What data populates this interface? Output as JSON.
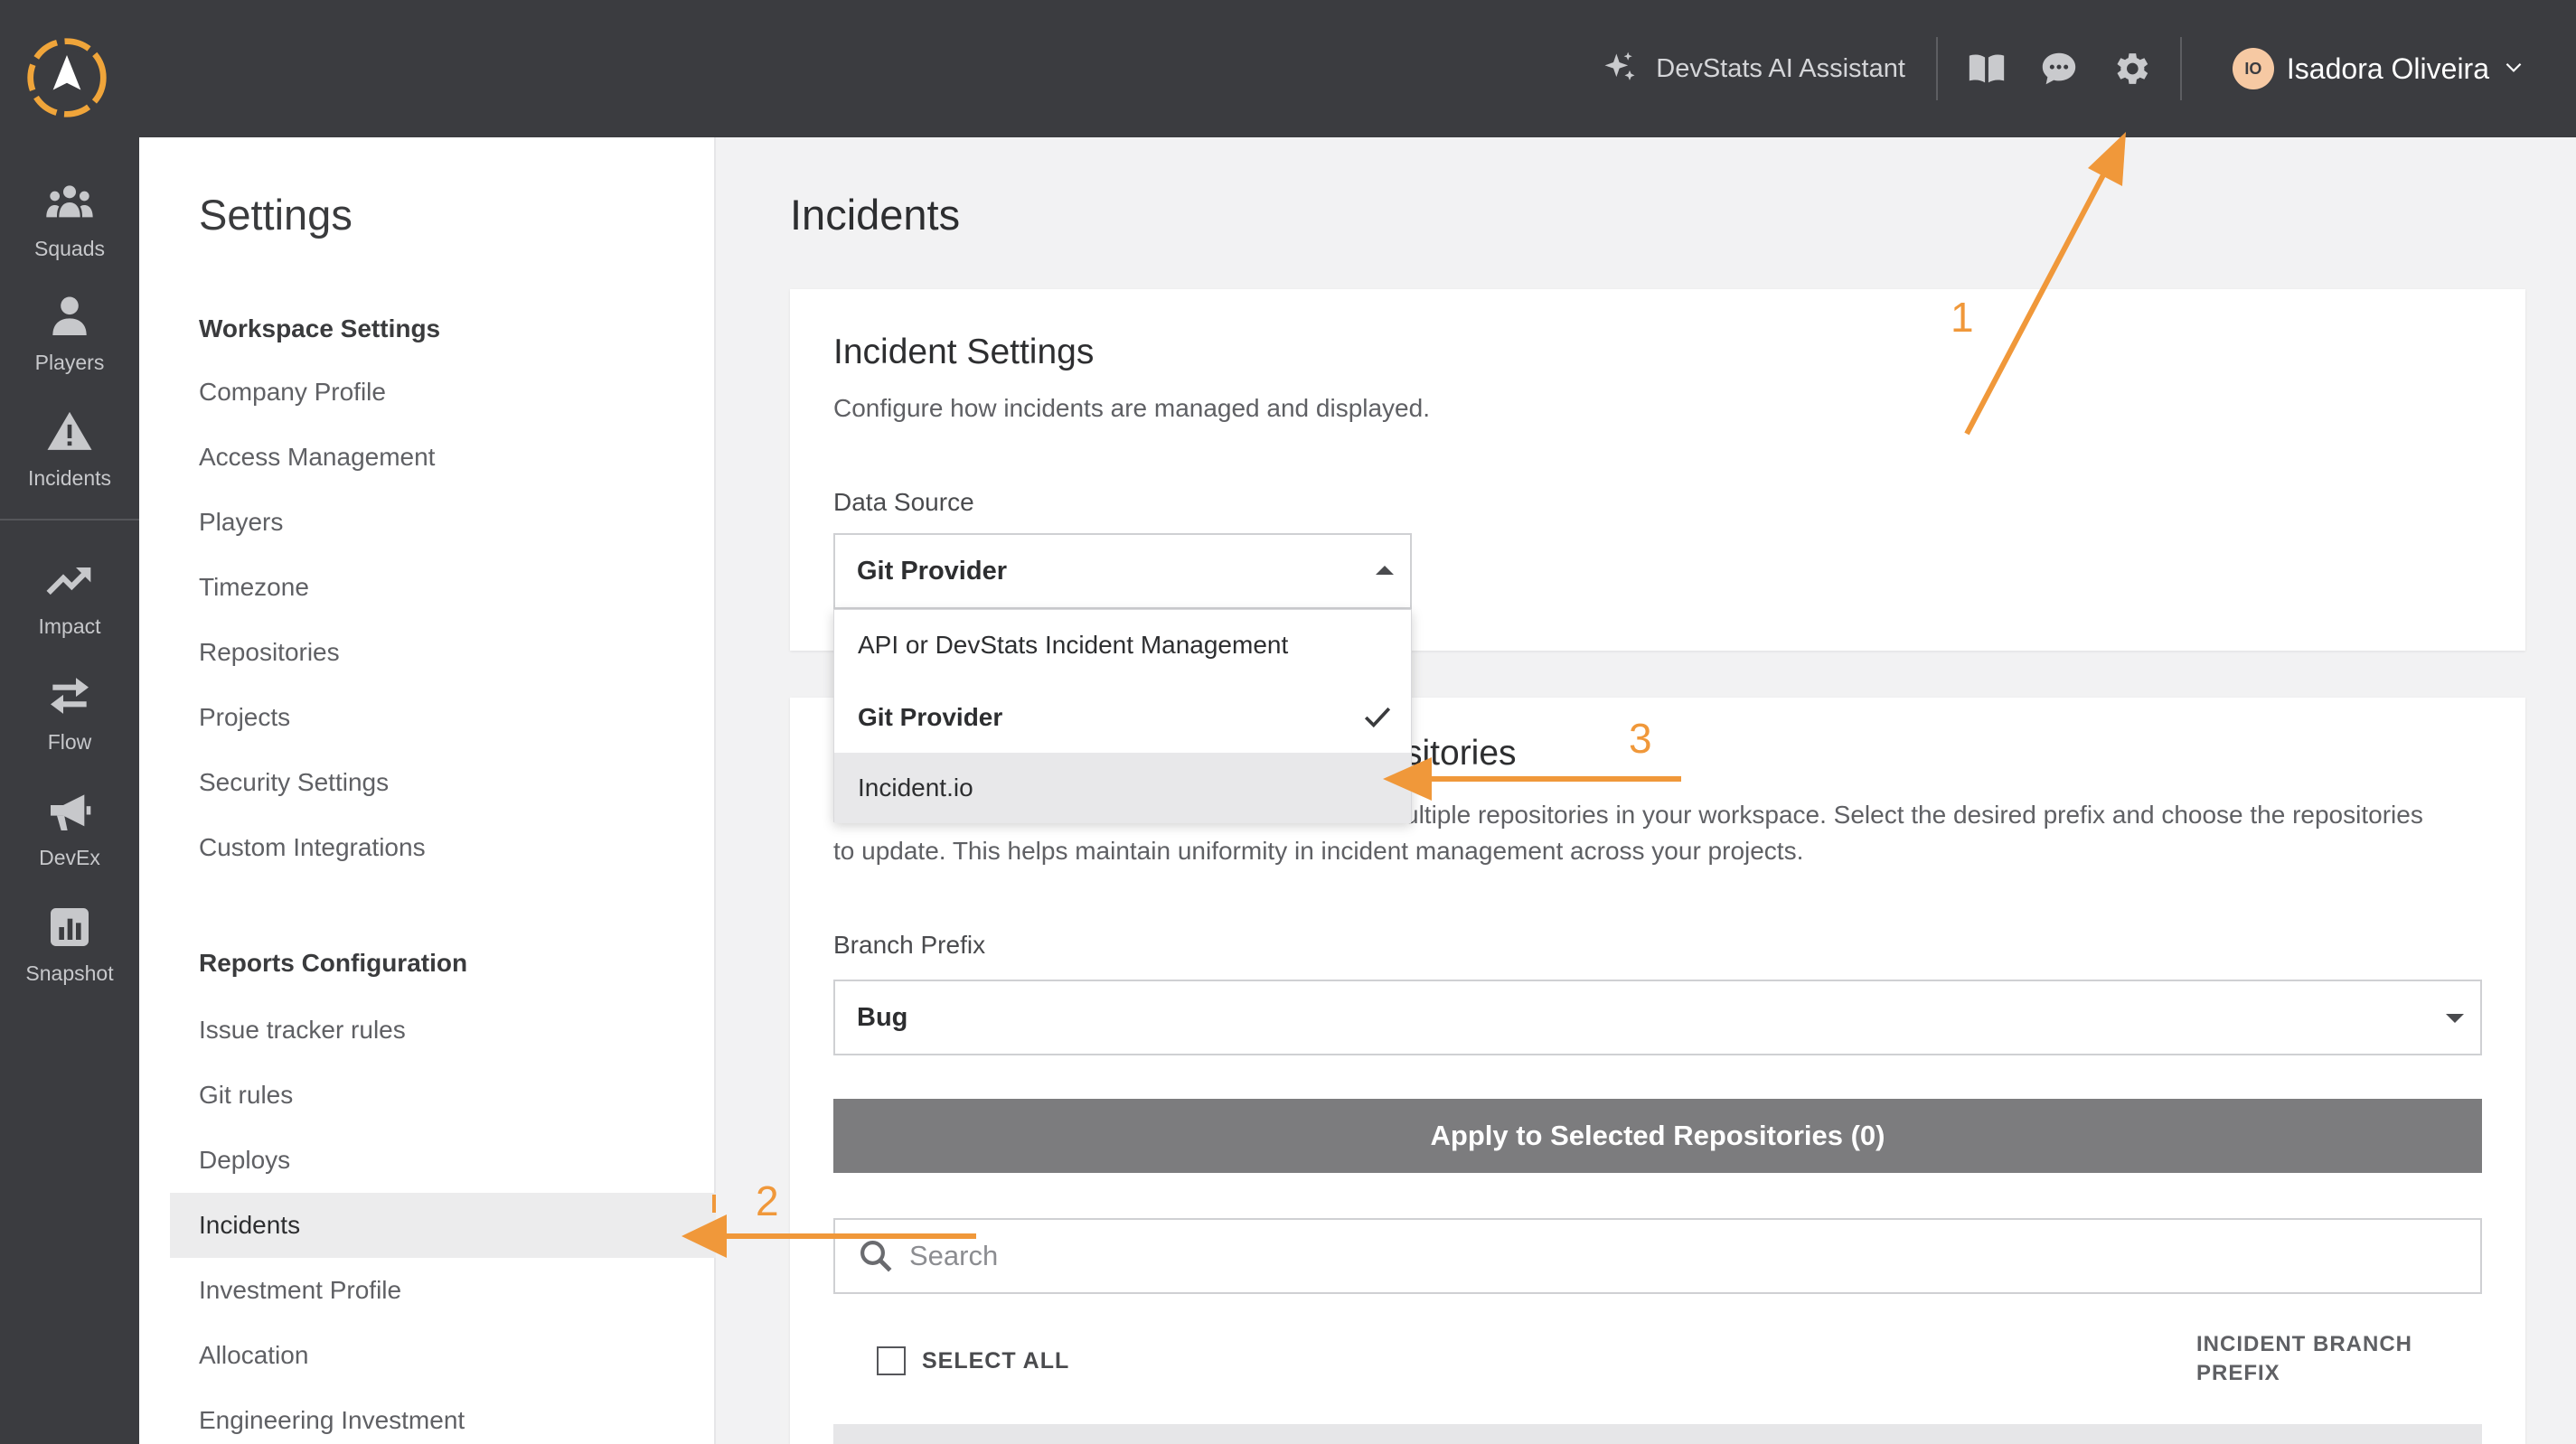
{
  "topbar": {
    "ai_assistant_label": "DevStats AI Assistant",
    "user_initials": "IO",
    "user_name": "Isadora Oliveira"
  },
  "rail": {
    "items": [
      {
        "label": "Squads",
        "icon": "users-icon"
      },
      {
        "label": "Players",
        "icon": "person-icon"
      },
      {
        "label": "Incidents",
        "icon": "warning-icon"
      },
      {
        "label": "Impact",
        "icon": "trend-up-icon"
      },
      {
        "label": "Flow",
        "icon": "arrows-swap-icon"
      },
      {
        "label": "DevEx",
        "icon": "megaphone-icon"
      },
      {
        "label": "Snapshot",
        "icon": "bar-chart-icon"
      }
    ]
  },
  "settings": {
    "title": "Settings",
    "workspace_heading": "Workspace Settings",
    "workspace_items": [
      "Company Profile",
      "Access Management",
      "Players",
      "Timezone",
      "Repositories",
      "Projects",
      "Security Settings",
      "Custom Integrations"
    ],
    "reports_heading": "Reports Configuration",
    "reports_items": [
      "Issue tracker rules",
      "Git rules",
      "Deploys",
      "Incidents",
      "Investment Profile",
      "Allocation",
      "Engineering Investment"
    ],
    "active_item": "Incidents"
  },
  "main": {
    "title": "Incidents",
    "incident_settings": {
      "title": "Incident Settings",
      "description": "Configure how incidents are managed and displayed.",
      "data_source_label": "Data Source",
      "data_source_value": "Git Provider",
      "options": [
        "API or DevStats Incident Management",
        "Git Provider",
        "Incident.io"
      ],
      "selected_option": "Git Provider",
      "hovered_option": "Incident.io"
    },
    "branch_card": {
      "title_visible": "sitories",
      "description_line1": "ultiple repositories in your workspace. Select the desired prefix and choose the repositories",
      "description_line2": "to update. This helps maintain uniformity in incident management across your projects.",
      "branch_prefix_label": "Branch Prefix",
      "branch_prefix_value": "Bug",
      "apply_button": "Apply to Selected Repositories (0)",
      "search_placeholder": "Search",
      "select_all_label": "SELECT ALL",
      "column_header_line1": "INCIDENT BRANCH",
      "column_header_line2": "PREFIX"
    }
  },
  "annotations": {
    "labels": [
      "1",
      "2",
      "3"
    ],
    "color": "#f0983a"
  },
  "colors": {
    "topbar": "#3b3c40",
    "accent_orange": "#f0983a",
    "apply_button": "#7c7c7e"
  }
}
